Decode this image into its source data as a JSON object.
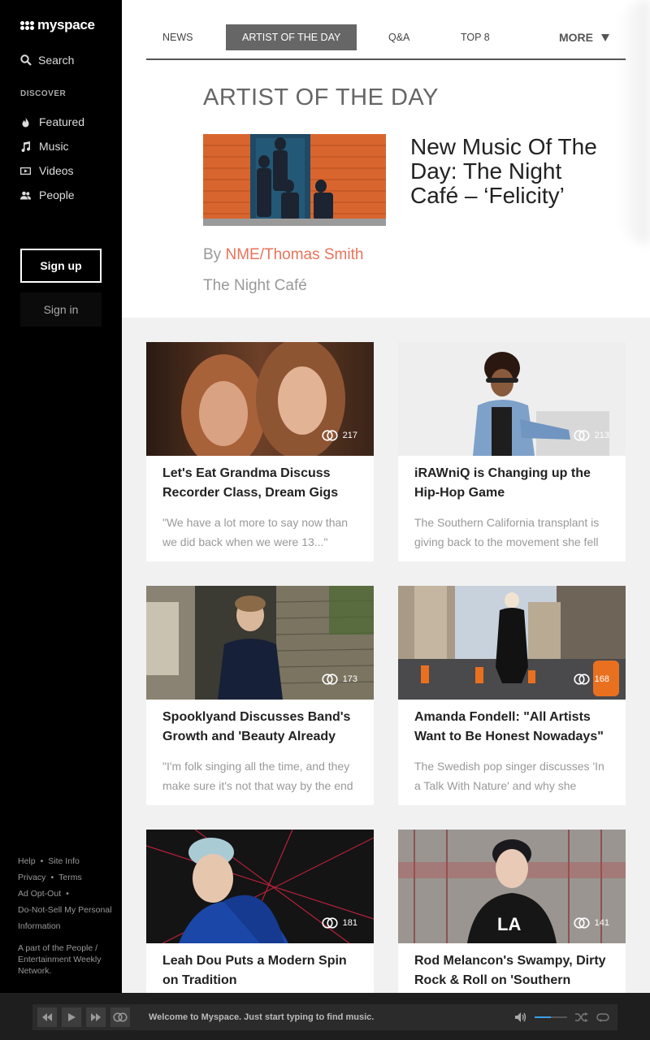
{
  "sidebar": {
    "logo_text": "myspace",
    "search_label": "Search",
    "discover_heading": "DISCOVER",
    "nav": [
      {
        "label": "Featured",
        "icon": "flame-icon"
      },
      {
        "label": "Music",
        "icon": "music-note-icon"
      },
      {
        "label": "Videos",
        "icon": "video-icon"
      },
      {
        "label": "People",
        "icon": "people-icon"
      }
    ],
    "signup_label": "Sign up",
    "signin_label": "Sign in",
    "footer_links": [
      "Help",
      "Site Info",
      "Privacy",
      "Terms",
      "Ad Opt-Out",
      "Do-Not-Sell My Personal Information"
    ],
    "footer_note": "A part of the People / Entertainment Weekly Network."
  },
  "tabs": {
    "items": [
      "NEWS",
      "ARTIST OF THE DAY",
      "Q&A",
      "TOP 8"
    ],
    "active": "ARTIST OF THE DAY",
    "more_label": "MORE"
  },
  "hero": {
    "section_title": "ARTIST OF THE DAY",
    "headline": "New Music Of The Day: The Night Café – ‘Felicity’",
    "by_prefix": "By",
    "author": "NME/Thomas Smith",
    "artist": "The Night Café"
  },
  "cards": [
    {
      "title": "Let's Eat Grandma Discuss Recorder Class, Dream Gigs",
      "desc": "\"We have a lot more to say now than we did back when we were 13...\"",
      "count": "217"
    },
    {
      "title": "iRAWniQ is Changing up the Hip-Hop Game",
      "desc": "The Southern California transplant is giving back to the movement she fell",
      "count": "213"
    },
    {
      "title": "Spooklyand Discusses Band's Growth and 'Beauty Already",
      "desc": "\"I'm folk singing all the time, and they make sure it's not that way by the end",
      "count": "173"
    },
    {
      "title": "Amanda Fondell: \"All Artists Want to Be Honest Nowadays\"",
      "desc": "The Swedish pop singer discusses 'In a Talk With Nature' and why she",
      "count": "168"
    },
    {
      "title": "Leah Dou Puts a Modern Spin on Tradition",
      "desc": "",
      "count": "181"
    },
    {
      "title": "Rod Melancon's Swampy, Dirty Rock & Roll on 'Southern",
      "desc": "",
      "count": "141"
    }
  ],
  "player": {
    "message": "Welcome to Myspace. Just start typing to find music.",
    "volume": 0.5,
    "accent_color": "#3aa0e8"
  }
}
